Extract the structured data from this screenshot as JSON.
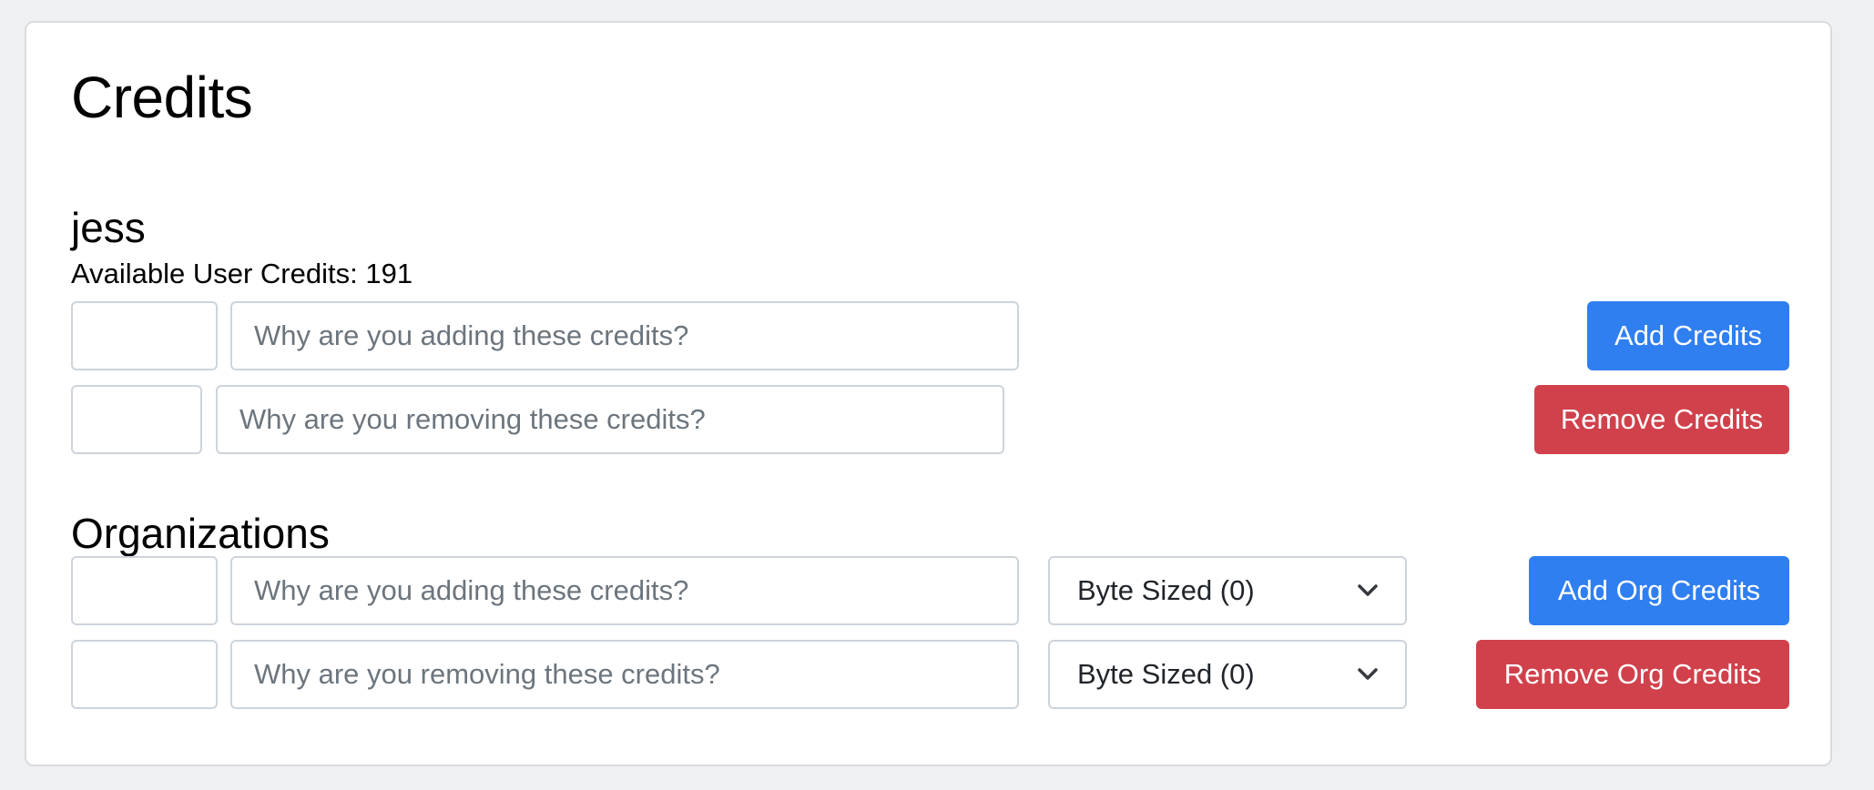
{
  "page": {
    "title": "Credits"
  },
  "user": {
    "name": "jess",
    "available_label": "Available User Credits: 191",
    "add": {
      "amount_value": "",
      "reason_placeholder": "Why are you adding these credits?",
      "button_label": "Add Credits"
    },
    "remove": {
      "amount_value": "",
      "reason_placeholder": "Why are you removing these credits?",
      "button_label": "Remove Credits"
    }
  },
  "organizations": {
    "title": "Organizations",
    "add": {
      "amount_value": "",
      "reason_placeholder": "Why are you adding these credits?",
      "selected_org": "Byte Sized (0)",
      "button_label": "Add Org Credits"
    },
    "remove": {
      "amount_value": "",
      "reason_placeholder": "Why are you removing these credits?",
      "selected_org": "Byte Sized (0)",
      "button_label": "Remove Org Credits"
    }
  },
  "colors": {
    "primary": "#2f7ff1",
    "danger": "#d0414b",
    "background": "#eff0f2",
    "border": "#ced4da"
  },
  "icons": {
    "select_arrow": "chevron-down-icon"
  }
}
